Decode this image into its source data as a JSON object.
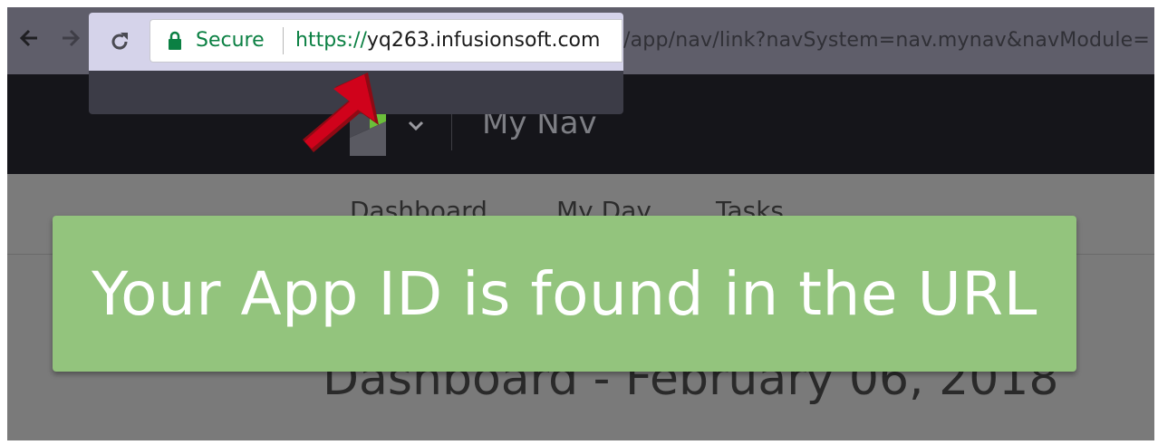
{
  "browser": {
    "security_label": "Secure",
    "url_scheme": "https://",
    "url_host": "yq263.infusionsoft.com",
    "url_path": "/app/nav/link?navSystem=nav.mynav&navModule=",
    "colors": {
      "secure_green": "#0b8043"
    }
  },
  "app_header": {
    "title": "My Nav",
    "logo_icon": "infusionsoft-logo-icon",
    "menu_icon": "chevron-down-icon"
  },
  "subnav": {
    "items": [
      "Dashboard",
      "My Day",
      "Tasks"
    ]
  },
  "page": {
    "title": "Dashboard - February 06, 2018"
  },
  "annotation": {
    "banner_text": "Your App ID is found in the URL",
    "banner_color": "#93c47d",
    "arrow_color": "#d0021b"
  }
}
